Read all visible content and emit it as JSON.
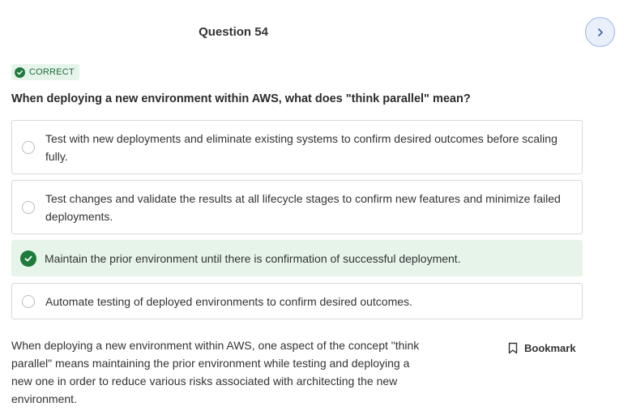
{
  "header": {
    "question_title": "Question 54",
    "next_icon": "chevron-right-icon"
  },
  "status": {
    "badge_label": "CORRECT",
    "badge_icon": "check-circle-icon",
    "color": "#1e7b3c"
  },
  "question": {
    "text": "When deploying a new environment within AWS, what does \"think parallel\" mean?"
  },
  "options": [
    {
      "text": "Test with new deployments and eliminate existing systems to confirm desired outcomes before scaling fully.",
      "state": "unselected"
    },
    {
      "text": "Test changes and validate the results at all lifecycle stages to confirm new features and minimize failed deployments.",
      "state": "unselected"
    },
    {
      "text": "Maintain the prior environment until there is confirmation of successful deployment.",
      "state": "correct-selected"
    },
    {
      "text": "Automate testing of deployed environments to confirm desired outcomes.",
      "state": "unselected"
    }
  ],
  "explanation": {
    "text": "When deploying a new environment within AWS, one aspect of the concept \"think parallel\" means maintaining the prior environment while testing and deploying a new one in order to reduce various risks associated with architecting the new environment."
  },
  "bookmark": {
    "label": "Bookmark",
    "icon": "bookmark-icon"
  }
}
